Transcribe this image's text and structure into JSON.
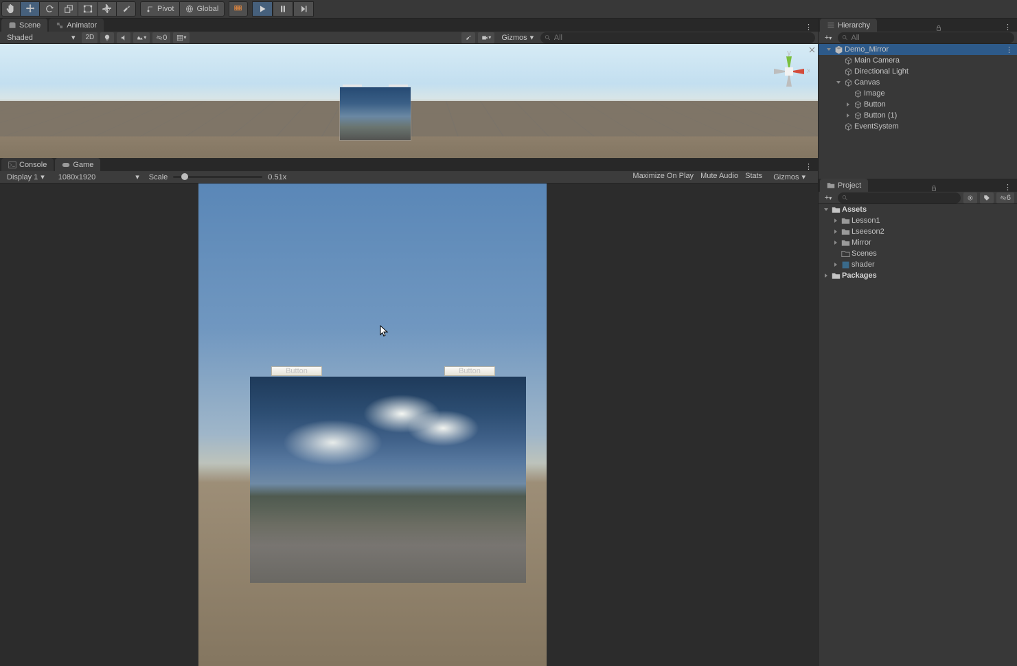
{
  "toolbar": {
    "pivot_label": "Pivot",
    "global_label": "Global"
  },
  "scene": {
    "tab_label": "Scene",
    "animator_tab_label": "Animator",
    "shading_mode": "Shaded",
    "mode_2d": "2D",
    "layers_count": "0",
    "gizmos_label": "Gizmos",
    "search_placeholder": "All"
  },
  "console_tab": "Console",
  "game_tab": "Game",
  "game": {
    "display_label": "Display 1",
    "resolution": "1080x1920",
    "scale_label": "Scale",
    "scale_value": "0.51x",
    "max_on_play": "Maximize On Play",
    "mute": "Mute Audio",
    "stats": "Stats",
    "gizmos": "Gizmos",
    "button1_label": "Button",
    "button2_label": "Button"
  },
  "hierarchy": {
    "tab_label": "Hierarchy",
    "search_placeholder": "All",
    "items": [
      {
        "depth": 0,
        "fold": "down",
        "icon": "unity",
        "label": "Demo_Mirror",
        "sel": true
      },
      {
        "depth": 1,
        "fold": "none",
        "icon": "cube",
        "label": "Main Camera"
      },
      {
        "depth": 1,
        "fold": "none",
        "icon": "cube",
        "label": "Directional Light"
      },
      {
        "depth": 1,
        "fold": "down",
        "icon": "cube",
        "label": "Canvas"
      },
      {
        "depth": 2,
        "fold": "none",
        "icon": "cube",
        "label": "Image"
      },
      {
        "depth": 2,
        "fold": "right",
        "icon": "cube",
        "label": "Button"
      },
      {
        "depth": 2,
        "fold": "right",
        "icon": "cube",
        "label": "Button (1)"
      },
      {
        "depth": 1,
        "fold": "none",
        "icon": "cube",
        "label": "EventSystem"
      }
    ]
  },
  "project": {
    "tab_label": "Project",
    "toolbar_eye": "6",
    "items": [
      {
        "depth": 0,
        "fold": "down",
        "icon": "folder-bold",
        "label": "Assets",
        "bold": true
      },
      {
        "depth": 1,
        "fold": "right",
        "icon": "folder",
        "label": "Lesson1"
      },
      {
        "depth": 1,
        "fold": "right",
        "icon": "folder",
        "label": "Lseeson2"
      },
      {
        "depth": 1,
        "fold": "right",
        "icon": "folder",
        "label": "Mirror"
      },
      {
        "depth": 1,
        "fold": "none",
        "icon": "folder-empty",
        "label": "Scenes"
      },
      {
        "depth": 1,
        "fold": "right",
        "icon": "shader",
        "label": "shader"
      },
      {
        "depth": 0,
        "fold": "right",
        "icon": "folder-bold",
        "label": "Packages",
        "bold": true
      }
    ]
  }
}
